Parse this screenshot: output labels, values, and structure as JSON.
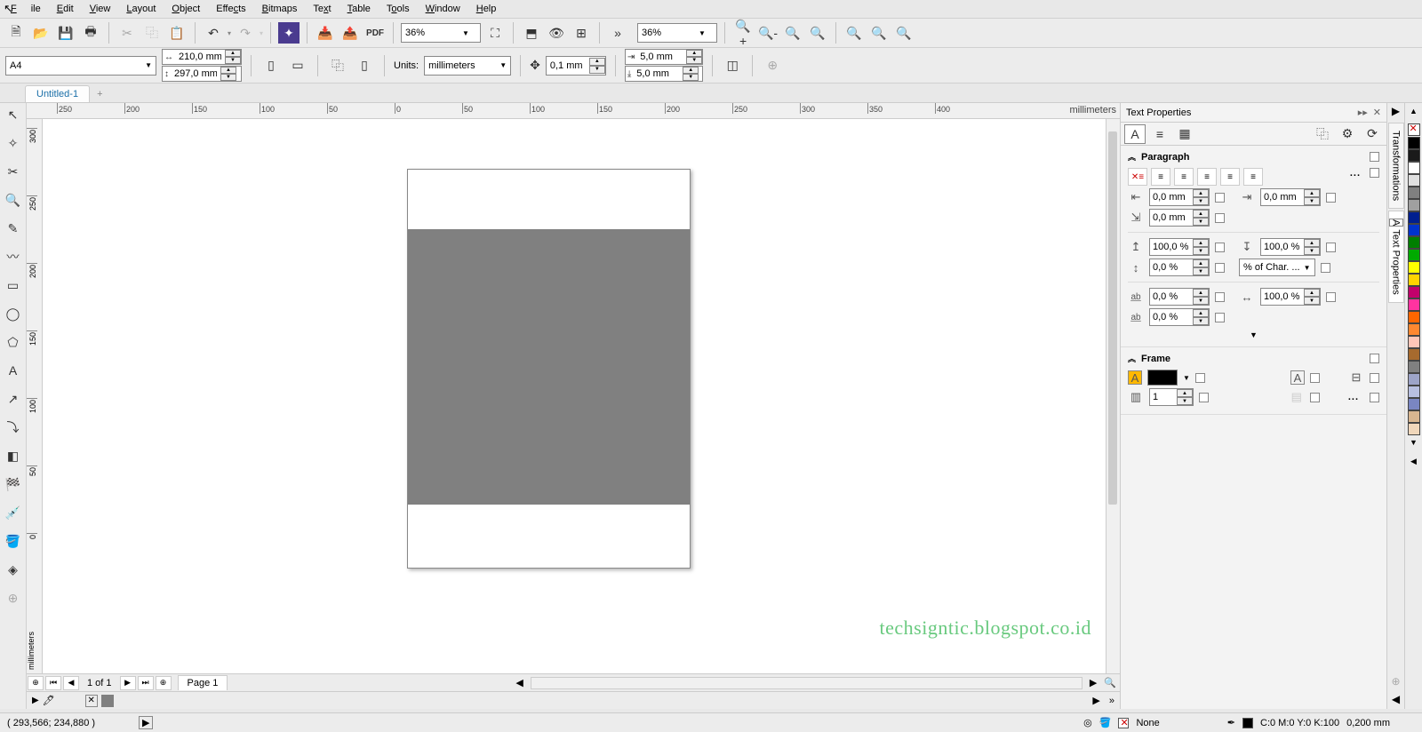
{
  "menu": {
    "file": "File",
    "edit": "Edit",
    "view": "View",
    "layout": "Layout",
    "object": "Object",
    "effects": "Effects",
    "bitmaps": "Bitmaps",
    "text": "Text",
    "table": "Table",
    "tools": "Tools",
    "window": "Window",
    "help": "Help"
  },
  "toolbar1": {
    "zoom1": "36%",
    "zoom2": "36%"
  },
  "propbar": {
    "paper": "A4",
    "width": "210,0 mm",
    "height": "297,0 mm",
    "units_label": "Units:",
    "units_value": "millimeters",
    "nudge": "0,1 mm",
    "dup_x": "5,0 mm",
    "dup_y": "5,0 mm"
  },
  "doc": {
    "tab": "Untitled-1"
  },
  "ruler": {
    "units": "millimeters",
    "hticks": [
      "250",
      "200",
      "150",
      "100",
      "50",
      "0",
      "50",
      "100",
      "150",
      "200",
      "250",
      "300",
      "350",
      "400"
    ],
    "vticks": [
      "300",
      "250",
      "200",
      "150",
      "100",
      "50",
      "0"
    ]
  },
  "watermark": "techsigntic.blogspot.co.id",
  "pagenav": {
    "counter": "1 of 1",
    "page": "Page 1"
  },
  "docker": {
    "title": "Text Properties",
    "paragraph": {
      "title": "Paragraph",
      "left_indent": "0,0 mm",
      "right_indent": "0,0 mm",
      "first_line": "0,0 mm",
      "before": "100,0 %",
      "after": "100,0 %",
      "line": "0,0 %",
      "char_combo": "% of Char. ...",
      "char_spacing": "0,0 %",
      "word_spacing": "100,0 %",
      "lang_spacing": "0,0 %"
    },
    "frame": {
      "title": "Frame",
      "columns": "1"
    }
  },
  "sidetabs": {
    "t1": "Transformations",
    "t2": "Text Properties"
  },
  "palette_colors": [
    "#000000",
    "#1a1a1a",
    "#ffffff",
    "#e0e0e0",
    "#808080",
    "#a0a0a0",
    "#001f8f",
    "#0033cc",
    "#007f00",
    "#00aa00",
    "#ffff00",
    "#ffd400",
    "#c2006b",
    "#ff33a0",
    "#ff6600",
    "#ff8830",
    "#ffc6b8",
    "#a66a2e",
    "#808080",
    "#9da4c8",
    "#b8bfe0",
    "#7a86c2",
    "#d8b690",
    "#f0d7bb"
  ],
  "status": {
    "coords": "( 293,566; 234,880 )",
    "fill_label": "None",
    "cmyk": "C:0 M:0 Y:0 K:100",
    "outline": "0,200 mm"
  }
}
